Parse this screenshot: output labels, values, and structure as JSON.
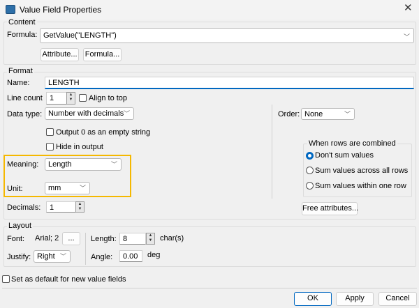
{
  "window": {
    "title": "Value Field Properties",
    "icon": "app-icon",
    "close_icon": "close-icon"
  },
  "content": {
    "group_label": "Content",
    "formula_label": "Formula:",
    "formula_value": "GetValue(\"LENGTH\")",
    "attribute_button": "Attribute...",
    "formula_button": "Formula..."
  },
  "format": {
    "group_label": "Format",
    "name_label": "Name:",
    "name_value": "LENGTH",
    "line_count_label": "Line count",
    "line_count_value": "1",
    "align_to_top_label": "Align to top",
    "align_to_top_checked": false,
    "data_type_label": "Data type:",
    "data_type_value": "Number with decimals",
    "output0_label": "Output 0 as an empty string",
    "output0_checked": false,
    "hide_label": "Hide in output",
    "hide_checked": false,
    "meaning_label": "Meaning:",
    "meaning_value": "Length",
    "unit_label": "Unit:",
    "unit_value": "mm",
    "decimals_label": "Decimals:",
    "decimals_value": "1",
    "order_label": "Order:",
    "order_value": "None",
    "combine_group_label": "When rows are combined",
    "combine_options": [
      "Don't sum values",
      "Sum values across all rows",
      "Sum values within one row"
    ],
    "combine_selected": "Don't sum values",
    "free_attributes_button": "Free attributes...",
    "highlight_color": "#f5b800"
  },
  "layout": {
    "group_label": "Layout",
    "font_label": "Font:",
    "font_value": "Arial; 2",
    "font_button": "...",
    "justify_label": "Justify:",
    "justify_value": "Right",
    "length_label": "Length:",
    "length_value": "8",
    "length_unit": "char(s)",
    "angle_label": "Angle:",
    "angle_value": "0.00",
    "angle_unit": "deg"
  },
  "default_checkbox_label": "Set as default for new value fields",
  "default_checked": false,
  "buttons": {
    "ok": "OK",
    "apply": "Apply",
    "cancel": "Cancel"
  },
  "accent_color": "#0067c0"
}
